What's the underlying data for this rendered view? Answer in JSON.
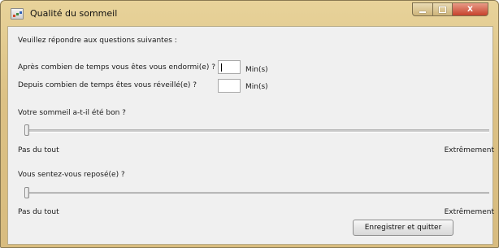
{
  "window": {
    "title": "Qualité du sommeil",
    "controls": {
      "minimize": "minimize",
      "maximize": "maximize",
      "close": "X"
    }
  },
  "form": {
    "instruction": "Veuillez répondre aux questions suivantes :",
    "fields": [
      {
        "label": "Après combien de temps vous êtes vous endormi(e) ?",
        "value": "",
        "unit": "Min(s)"
      },
      {
        "label": "Depuis combien de temps êtes vous réveillé(e) ?",
        "value": "",
        "unit": "Min(s)"
      }
    ],
    "sliders": [
      {
        "question": "Votre sommeil a-t-il été bon ?",
        "min_label": "Pas du tout",
        "max_label": "Extrêmement",
        "value_fraction": 0
      },
      {
        "question": "Vous sentez-vous reposé(e) ?",
        "min_label": "Pas du tout",
        "max_label": "Extrêmement",
        "value_fraction": 0
      }
    ],
    "submit_label": "Enregistrer et quitter"
  },
  "icons": {
    "app": "app-window-icon",
    "minimize": "minimize-icon",
    "maximize": "maximize-icon",
    "close": "close-icon"
  },
  "colors": {
    "titlebar": "#dcc185",
    "close_button": "#c6422c",
    "client_background": "#f0f0f0"
  }
}
